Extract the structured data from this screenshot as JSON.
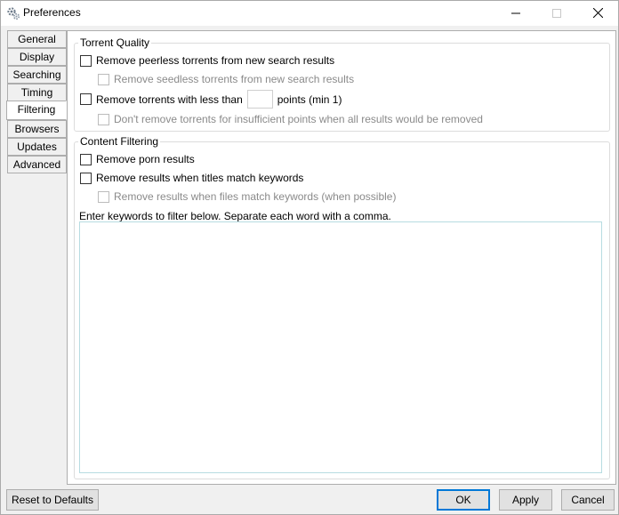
{
  "window": {
    "title": "Preferences"
  },
  "icons": {
    "app": "gears-icon",
    "minimize": "minimize-icon",
    "maximize": "maximize-icon",
    "close": "close-icon"
  },
  "tabs": [
    {
      "label": "General"
    },
    {
      "label": "Display"
    },
    {
      "label": "Searching"
    },
    {
      "label": "Timing"
    },
    {
      "label": "Filtering",
      "active": true
    },
    {
      "label": "Browsers"
    },
    {
      "label": "Updates"
    },
    {
      "label": "Advanced"
    }
  ],
  "torrent_quality": {
    "title": "Torrent Quality",
    "remove_peerless": {
      "label": "Remove peerless torrents from new search results",
      "checked": false
    },
    "remove_seedless": {
      "label": "Remove seedless torrents from new search results",
      "checked": false,
      "enabled": false
    },
    "remove_less_than": {
      "label_before": "Remove torrents with less than",
      "value": "",
      "label_after": "points (min 1)",
      "checked": false
    },
    "dont_remove": {
      "label": "Don't remove torrents for insufficient points when all results would be removed",
      "checked": false,
      "enabled": false
    }
  },
  "content_filtering": {
    "title": "Content Filtering",
    "remove_porn": {
      "label": "Remove porn results",
      "checked": false
    },
    "remove_titles": {
      "label": "Remove results when titles match keywords",
      "checked": false
    },
    "remove_files": {
      "label": "Remove results when files match keywords (when possible)",
      "checked": false,
      "enabled": false
    },
    "hint": "Enter keywords to filter below.  Separate each word with a comma.",
    "keywords_value": ""
  },
  "buttons": {
    "reset": "Reset to Defaults",
    "ok": "OK",
    "apply": "Apply",
    "cancel": "Cancel"
  },
  "colors": {
    "accent": "#0078d7",
    "keywords_border": "#b7dce1"
  }
}
